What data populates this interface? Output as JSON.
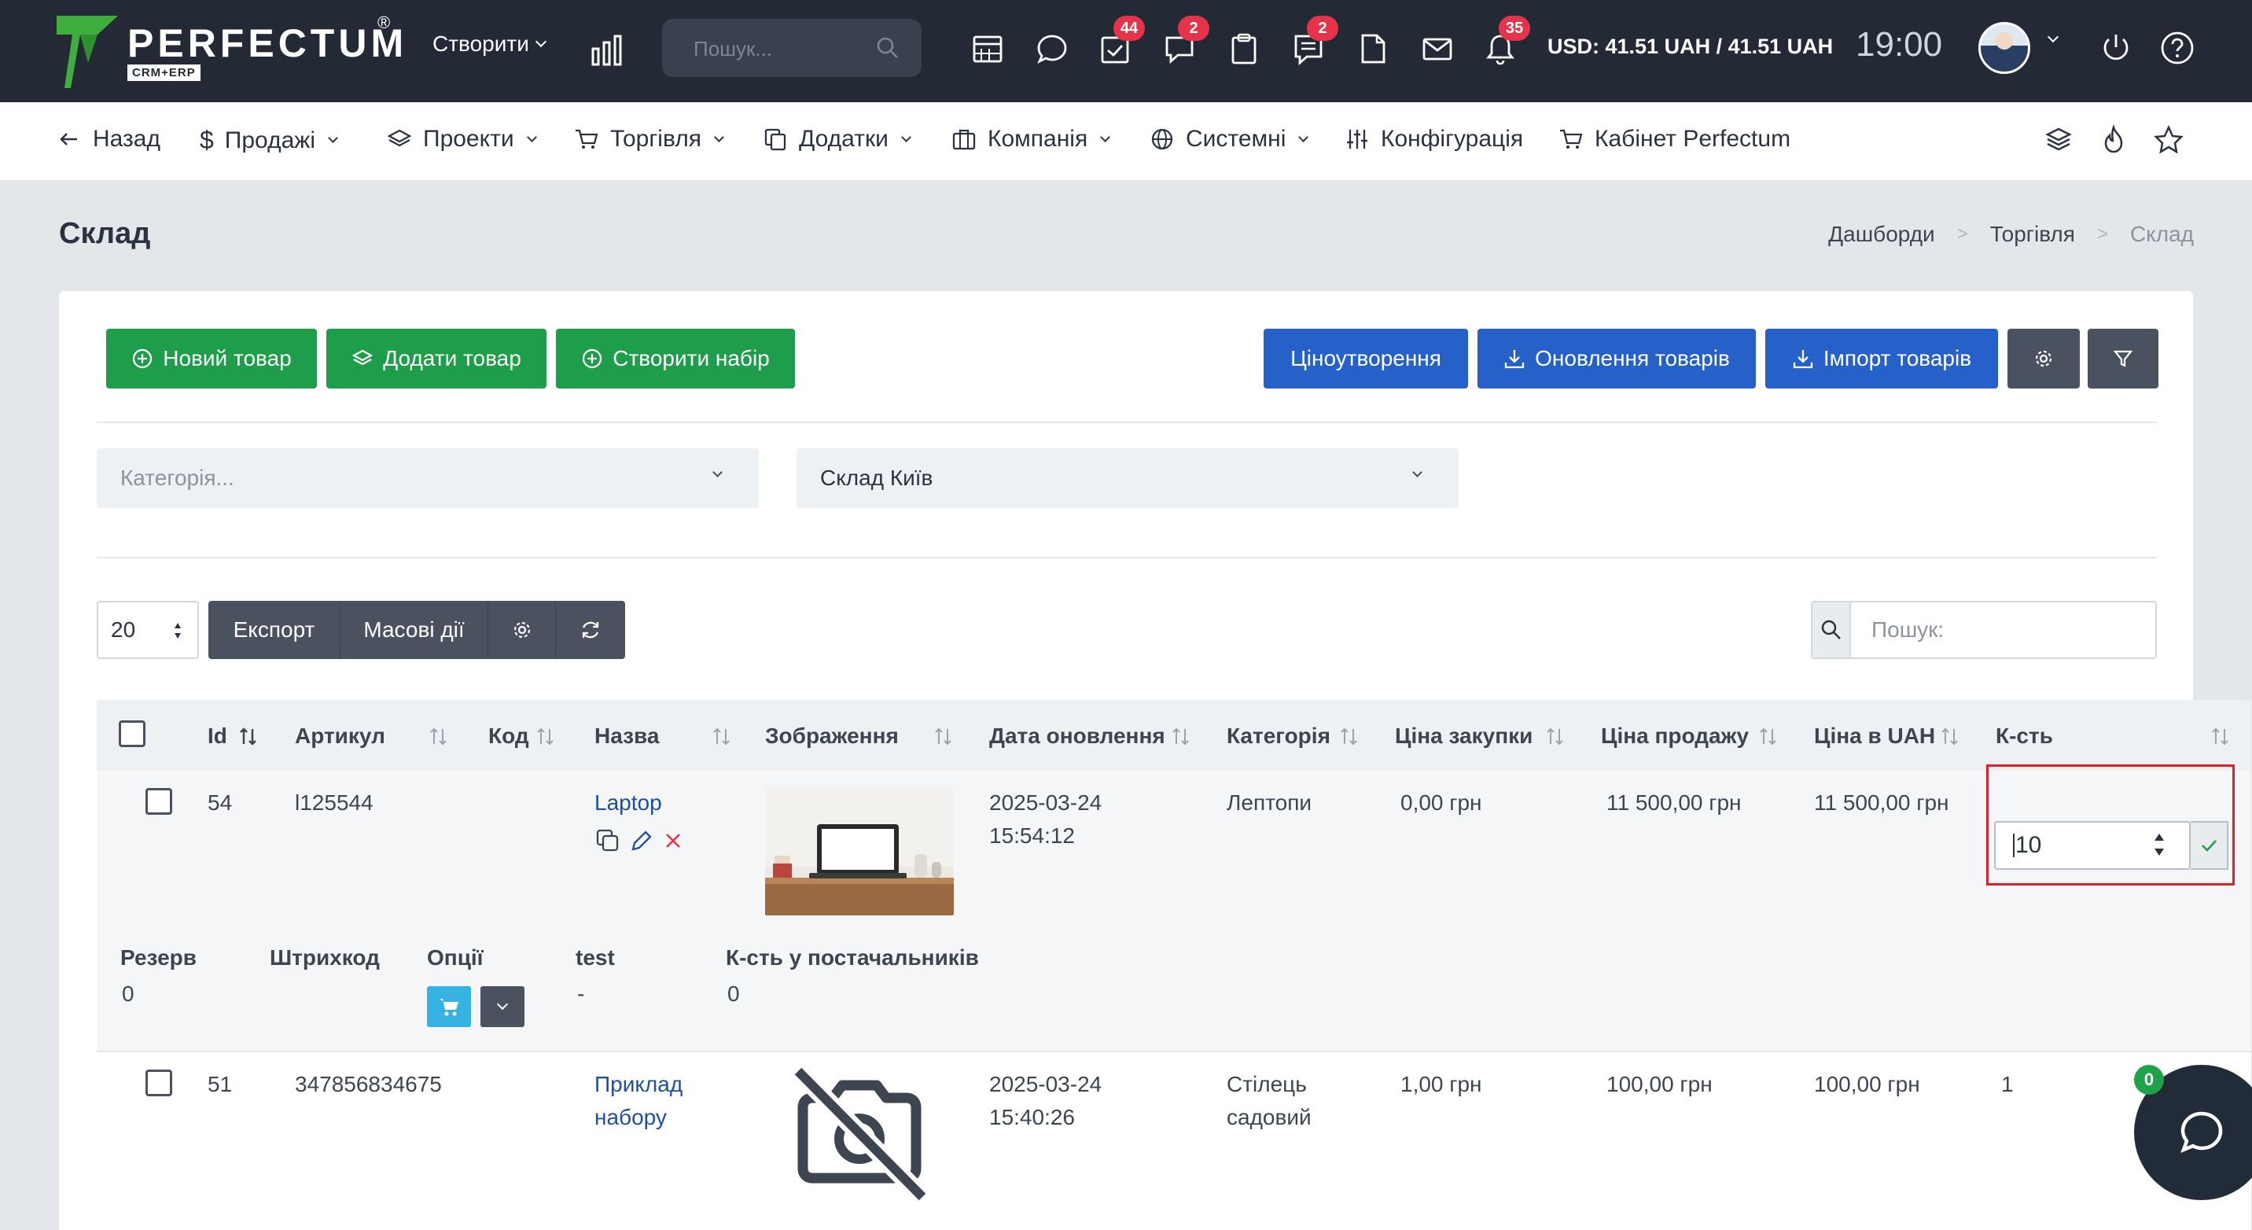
{
  "topbar": {
    "logo_text": "PERFECTUM",
    "logo_reg": "®",
    "logo_sub": "CRM+ERP",
    "create_label": "Створити",
    "search_placeholder": "Пошук...",
    "badges": {
      "tasks": "44",
      "messages": "2",
      "notes": "2",
      "notifications": "35"
    },
    "currency": "USD: 41.51 UAH / 41.51 UAH",
    "time": "19:00"
  },
  "subnav": {
    "back": "Назад",
    "sales": "Продажі",
    "projects": "Проекти",
    "trade": "Торгівля",
    "addons": "Додатки",
    "company": "Компанія",
    "system": "Системні",
    "config": "Конфігурація",
    "cabinet": "Кабінет Perfectum"
  },
  "page": {
    "title": "Склад",
    "breadcrumb": [
      "Дашборди",
      "Торгівля",
      "Склад"
    ]
  },
  "toolbar": {
    "new_product": "Новий товар",
    "add_product": "Додати товар",
    "create_set": "Створити набір",
    "pricing": "Ціноутворення",
    "update_products": "Оновлення товарів",
    "import_products": "Імпорт товарів"
  },
  "filters": {
    "category_placeholder": "Категорія...",
    "warehouse_value": "Склад Київ"
  },
  "table_controls": {
    "page_size": "20",
    "export": "Експорт",
    "mass_actions": "Масові дії",
    "search_placeholder": "Пошук:"
  },
  "table": {
    "headers": [
      "Id",
      "Артикул",
      "Код",
      "Назва",
      "Зображення",
      "Дата оновлення",
      "Категорія",
      "Ціна закупки",
      "Ціна продажу",
      "Ціна в UAH",
      "К-сть"
    ],
    "rows": [
      {
        "id": "54",
        "sku": "l125544",
        "code": "",
        "name": "Laptop",
        "date": "2025-03-24",
        "time": "15:54:12",
        "category": "Лептопи",
        "purchase": "0,00 грн",
        "sale": "11 500,00 грн",
        "uah": "11 500,00 грн",
        "qty": "10"
      },
      {
        "id": "51",
        "sku": "347856834675",
        "code": "",
        "name_line1": "Приклад",
        "name_line2": "набору",
        "date": "2025-03-24",
        "time": "15:40:26",
        "category_line1": "Стілець",
        "category_line2": "садовий",
        "purchase": "1,00 грн",
        "sale": "100,00 грн",
        "uah": "100,00 грн",
        "qty": "1"
      }
    ],
    "details": {
      "reserve_label": "Резерв",
      "reserve_value": "0",
      "barcode_label": "Штрихкод",
      "options_label": "Опції",
      "test_label": "test",
      "test_value": "-",
      "suppliers_label": "К-сть у постачальників",
      "suppliers_value": "0"
    }
  },
  "chat": {
    "badge": "0"
  },
  "colors": {
    "topbar": "#232a36",
    "green": "#1e9e4a",
    "blue": "#2561c9",
    "highlight": "#d9232d",
    "badge": "#e5344a"
  }
}
